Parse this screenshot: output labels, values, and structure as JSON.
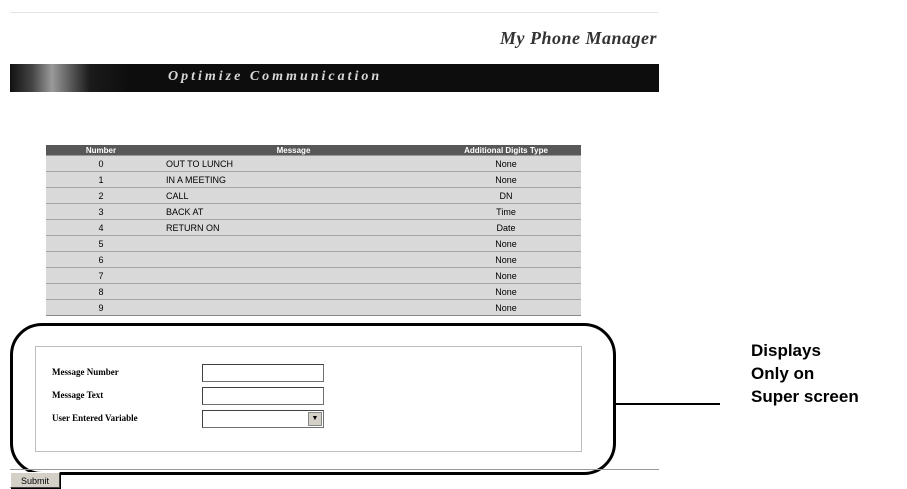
{
  "header": {
    "app_title": "My Phone Manager",
    "tagline": "Optimize Communication"
  },
  "table": {
    "columns": [
      "Number",
      "Message",
      "Additional Digits Type"
    ],
    "rows": [
      {
        "number": "0",
        "message": "OUT TO LUNCH",
        "type": "None"
      },
      {
        "number": "1",
        "message": "IN A MEETING",
        "type": "None"
      },
      {
        "number": "2",
        "message": "CALL",
        "type": "DN"
      },
      {
        "number": "3",
        "message": "BACK AT",
        "type": "Time"
      },
      {
        "number": "4",
        "message": "RETURN ON",
        "type": "Date"
      },
      {
        "number": "5",
        "message": "",
        "type": "None"
      },
      {
        "number": "6",
        "message": "",
        "type": "None"
      },
      {
        "number": "7",
        "message": "",
        "type": "None"
      },
      {
        "number": "8",
        "message": "",
        "type": "None"
      },
      {
        "number": "9",
        "message": "",
        "type": "None"
      }
    ]
  },
  "form": {
    "message_number": {
      "label": "Message Number",
      "value": ""
    },
    "message_text": {
      "label": "Message Text",
      "value": ""
    },
    "user_entered_variable": {
      "label": "User Entered Variable",
      "value": ""
    }
  },
  "callout": {
    "lines": [
      "Displays",
      "Only on",
      "Super screen"
    ]
  },
  "buttons": {
    "submit": "Submit"
  },
  "icons": {
    "select_arrow": "chevron-down-icon"
  }
}
